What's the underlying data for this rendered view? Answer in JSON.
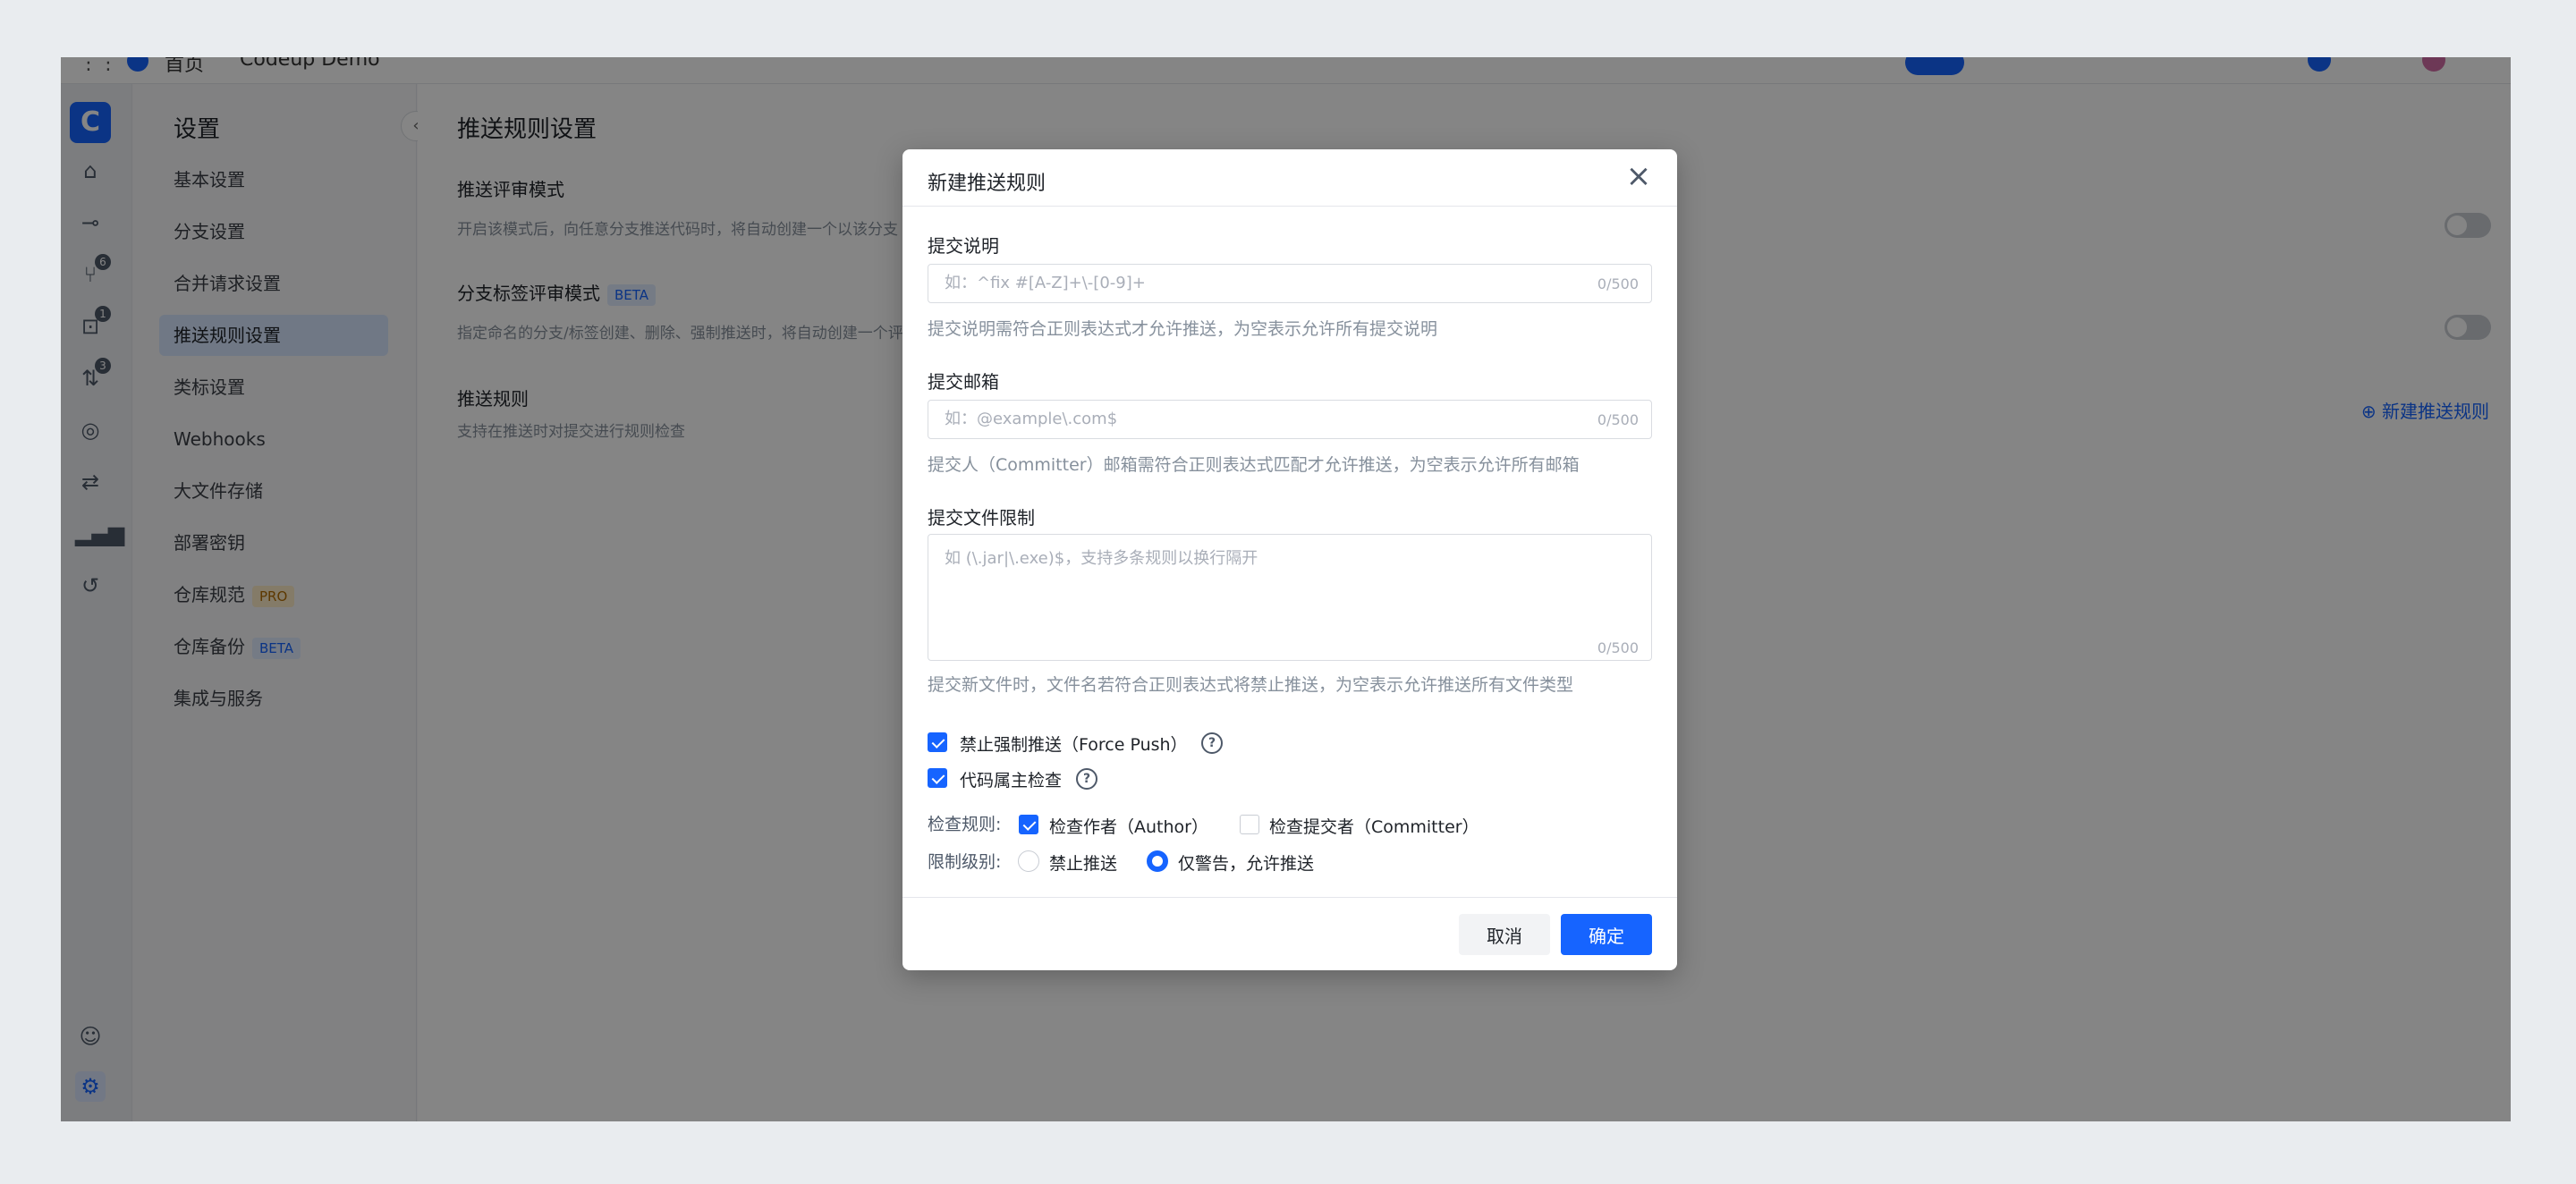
{
  "topbar": {
    "nav_home": "首页",
    "nav_project": "Codeup Demo"
  },
  "settings_sidebar": {
    "title": "设置",
    "items": [
      {
        "label": "基本设置"
      },
      {
        "label": "分支设置"
      },
      {
        "label": "合并请求设置"
      },
      {
        "label": "推送规则设置"
      },
      {
        "label": "类标设置"
      },
      {
        "label": "Webhooks"
      },
      {
        "label": "大文件存储"
      },
      {
        "label": "部署密钥"
      },
      {
        "label": "仓库规范",
        "tag": "PRO"
      },
      {
        "label": "仓库备份",
        "tag": "BETA"
      },
      {
        "label": "集成与服务"
      }
    ]
  },
  "rail": {
    "badges": [
      "6",
      "1",
      "3"
    ]
  },
  "main": {
    "title": "推送规则设置",
    "sections": [
      {
        "title": "推送评审模式",
        "desc": "开启该模式后，向任意分支推送代码时，将自动创建一个以该分支"
      },
      {
        "title": "分支标签评审模式",
        "tag": "BETA",
        "desc": "指定命名的分支/标签创建、删除、强制推送时，将自动创建一个评"
      },
      {
        "title": "推送规则",
        "desc": "支持在推送时对提交进行规则检查"
      }
    ],
    "new_rule_link": "新建推送规则"
  },
  "modal": {
    "title": "新建推送规则",
    "commit_msg": {
      "label": "提交说明",
      "placeholder": "如：^fix #[A-Z]+\\-[0-9]+",
      "counter": "0/500",
      "help": "提交说明需符合正则表达式才允许推送，为空表示允许所有提交说明"
    },
    "commit_email": {
      "label": "提交邮箱",
      "placeholder": "如：@example\\.com$",
      "counter": "0/500",
      "help": "提交人（Committer）邮箱需符合正则表达式匹配才允许推送，为空表示允许所有邮箱"
    },
    "file_limit": {
      "label": "提交文件限制",
      "placeholder": "如 (\\.jar|\\.exe)$，支持多条规则以换行隔开",
      "counter": "0/500",
      "help": "提交新文件时，文件名若符合正则表达式将禁止推送，为空表示允许推送所有文件类型"
    },
    "force_push": {
      "label": "禁止强制推送（Force Push）",
      "checked": true
    },
    "owner_check": {
      "label": "代码属主检查",
      "checked": true
    },
    "check_rule": {
      "label": "检查规则:",
      "author": {
        "label": "检查作者（Author）",
        "checked": true
      },
      "committer": {
        "label": "检查提交者（Committer）",
        "checked": false
      }
    },
    "limit_level": {
      "label": "限制级别:",
      "options": [
        {
          "label": "禁止推送",
          "selected": false
        },
        {
          "label": "仅警告，允许推送",
          "selected": true
        }
      ]
    },
    "cancel_label": "取消",
    "ok_label": "确定"
  },
  "colors": {
    "primary": "#1664ff",
    "backdrop": "rgba(0,0,0,0.48)"
  }
}
